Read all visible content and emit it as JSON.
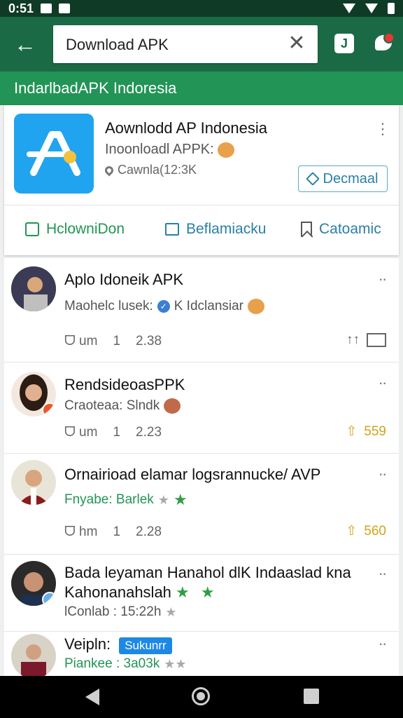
{
  "status_bar": {
    "time": "0:51"
  },
  "toolbar": {
    "search_value": "Download APK",
    "clear_symbol": "✕",
    "j_icon_label": "J"
  },
  "subbar": {
    "title": "IndarlbadAPK Indoresia"
  },
  "app_card": {
    "title": "Aownlodd AP Indonesia",
    "subtitle": "Inoonloadl APPK:",
    "meta": "Cawnla(12:3K",
    "primary_button": "Decmaal",
    "actions": [
      {
        "label": "HclowniDon",
        "color": "#229456"
      },
      {
        "label": "Beflamiacku",
        "color": "#2a7fa8"
      },
      {
        "label": "Catoamic",
        "color": "#2a7fa8"
      }
    ]
  },
  "feed": [
    {
      "title": "Aplo Idoneik APK",
      "line": "Maohelc lusek:",
      "line_tail": "K Idclansiar",
      "stats": [
        "ᗜ um",
        "1",
        "2.38"
      ],
      "right": ""
    },
    {
      "title": "RendsideoasPPK",
      "line": "Craoteaa: Slndk",
      "stats": [
        "ᗜ um",
        "1",
        "2.23"
      ],
      "right": "559"
    },
    {
      "title": "Ornairioad elamar logsrannucke/ AVP",
      "line": "Fnyabe: Barlek",
      "stats": [
        "ᗜ hm",
        "1",
        "2.28"
      ],
      "right": "560"
    },
    {
      "title": "Bada leyaman Hanahol dlK Indaaslad kna",
      "title2": "Kahonanahslah",
      "line": "lConlab : 15:22h"
    },
    {
      "title": "Veipln:",
      "chip": "Sukunrr",
      "line": "Piankee : 3a03k"
    }
  ],
  "colors": {
    "toolbar": "#1a6b45",
    "subbar": "#229456",
    "accent_blue": "#2a7fa8",
    "gold": "#d4a21a"
  }
}
